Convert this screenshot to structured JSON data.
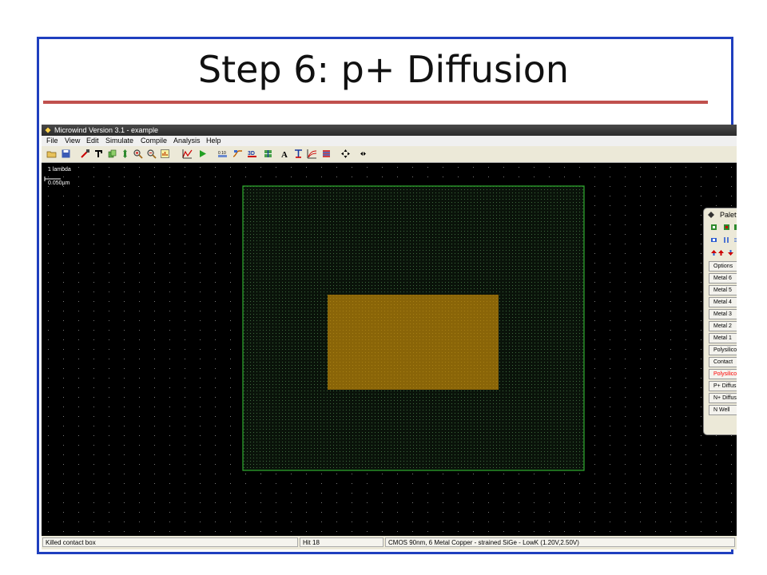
{
  "slide": {
    "title": "Step 6: p+ Diffusion"
  },
  "window": {
    "title": "Microwind Version 3.1 - example",
    "menu": [
      "File",
      "View",
      "Edit",
      "Simulate",
      "Compile",
      "Analysis",
      "Help"
    ]
  },
  "canvas": {
    "scale_lambda": "1 lambda",
    "scale_um": "0.050µm"
  },
  "palette": {
    "title": "Palett",
    "layers": [
      "Options",
      "Metal 6",
      "Metal 5",
      "Metal 4",
      "Metal 3",
      "Metal 2",
      "Metal 1",
      "Polysilico",
      "Contact",
      "Polysilico",
      "P+ Diffus",
      "N+ Diffus",
      "N Well"
    ],
    "selected_index": 9
  },
  "status": {
    "message": "Killed contact box",
    "hit": "Hit 18",
    "technology": "CMOS 90nm, 6 Metal Copper - strained SiGe - LowK (1.20V,2.50V)"
  },
  "colors": {
    "frame_border": "#1f3fbf",
    "title_rule": "#c0504d",
    "nwell_outline": "#2fae2f",
    "pdiff_fill": "#8a6508",
    "selected_layer_text": "#ff0000"
  }
}
